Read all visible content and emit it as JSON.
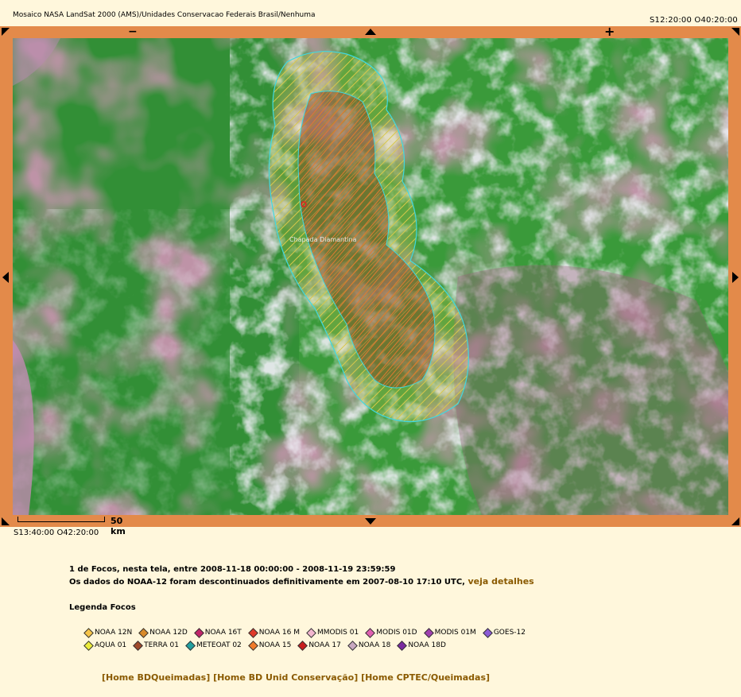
{
  "header": {
    "title": "Mosaico NASA LandSat 2000 (AMS)/Unidades Conservacao Federais Brasil/Nenhuma",
    "coord_ne": "S12:20:00 O40:20:00"
  },
  "map": {
    "nav": {
      "zoom_out": "−",
      "zoom_in": "+"
    },
    "scale_label": "50 km",
    "area_label": "Chapada Diamantina",
    "coord_sw": "S13:40:00 O42:20:00"
  },
  "info": {
    "line1": "1 de Focos, nesta tela, entre 2008-11-18 00:00:00 - 2008-11-19 23:59:59",
    "line2": "Os dados do NOAA-12 foram descontinuados definitivamente em 2007-08-10 17:10 UTC,",
    "link": "veja detalhes"
  },
  "legend": {
    "title": "Legenda Focos",
    "row1": [
      {
        "label": "NOAA 12N",
        "color": "#f6c44a"
      },
      {
        "label": "NOAA 12D",
        "color": "#d88a2a"
      },
      {
        "label": "NOAA 16T",
        "color": "#c2256a"
      },
      {
        "label": "NOAA 16 M",
        "color": "#e03a2a"
      },
      {
        "label": "MMODIS 01",
        "color": "#f2b6cf"
      },
      {
        "label": "MODIS 01D",
        "color": "#e060b0"
      },
      {
        "label": "MODIS 01M",
        "color": "#a040b0"
      },
      {
        "label": "GOES-12",
        "color": "#8b5bd6"
      }
    ],
    "row2": [
      {
        "label": "AQUA 01",
        "color": "#ecec3a"
      },
      {
        "label": "TERRA 01",
        "color": "#a04a2a"
      },
      {
        "label": "METEOAT 02",
        "color": "#22a0a0"
      },
      {
        "label": "NOAA 15",
        "color": "#f07a2a"
      },
      {
        "label": "NOAA 17",
        "color": "#c81e1e"
      },
      {
        "label": "NOAA 18",
        "color": "#c8a8c0"
      },
      {
        "label": "NOAA 18D",
        "color": "#7a2aa0"
      }
    ]
  },
  "links": {
    "l1": "[Home BDQueimadas]",
    "l2": "[Home BD Unid Conservação]",
    "l3": "[Home CPTEC/Queimadas]"
  }
}
